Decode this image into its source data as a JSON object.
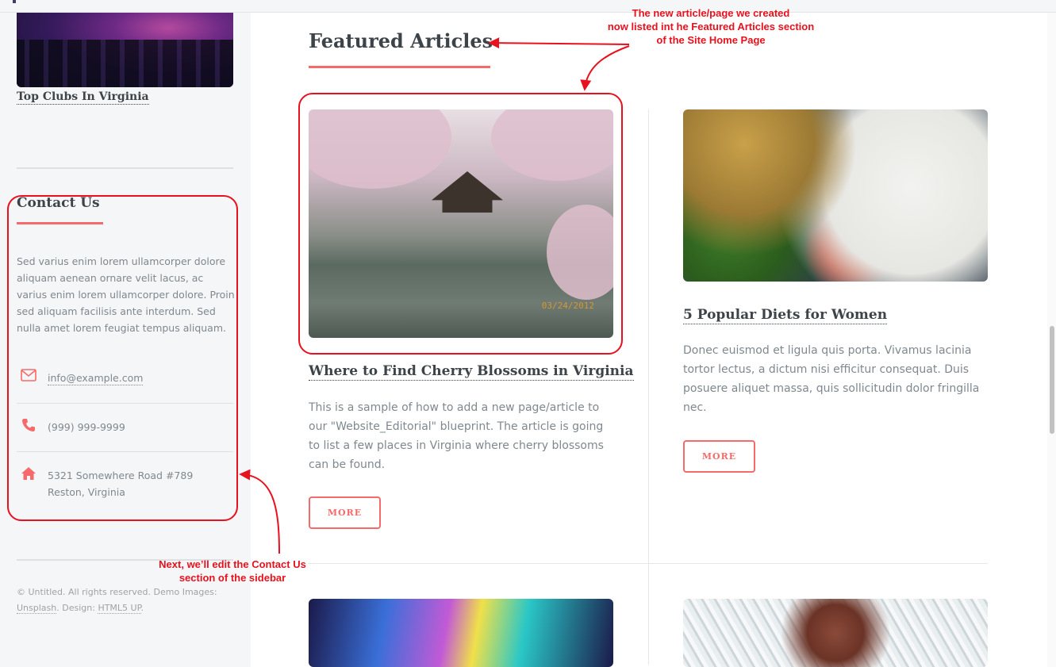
{
  "sidebar": {
    "recent_item_title": "Top Clubs In Virginia",
    "contact": {
      "heading": "Contact Us",
      "description": "Sed varius enim lorem ullamcorper dolore aliquam aenean ornare velit lacus, ac varius enim lorem ullamcorper dolore. Proin sed aliquam facilisis ante interdum. Sed nulla amet lorem feugiat tempus aliquam.",
      "email": "info@example.com",
      "phone": "(999) 999-9999",
      "address_line1": "5321 Somewhere Road #789",
      "address_line2": "Reston, Virginia"
    },
    "footer": {
      "prefix": "© Untitled. All rights reserved. Demo Images:",
      "unsplash": "Unsplash",
      "design_label": ". Design: ",
      "html5up": "HTML5 UP",
      "suffix": "."
    }
  },
  "main": {
    "section_title": "Featured Articles",
    "articles": [
      {
        "title": "Where to Find Cherry Blossoms in Virginia",
        "text": "This is a sample of how to add a new page/article to our \"Website_Editorial\" blueprint. The article is going to list a few places in Virginia where cherry blossoms can be found.",
        "button": "MORE",
        "image_caption_date": "03/24/2012"
      },
      {
        "title": "5 Popular Diets for Women",
        "text": "Donec euismod et ligula quis porta. Vivamus lacinia tortor lectus, a dictum nisi efficitur consequat. Duis posuere aliquet massa, quis sollicitudin dolor fringilla nec.",
        "button": "MORE"
      }
    ]
  },
  "annotations": {
    "featured_note": "The new article/page we created\nnow listed int he Featured Articles section\nof the Site Home Page",
    "contact_note": "Next, we’ll edit the Contact Us\nsection of the sidebar"
  },
  "icons": {
    "email": "envelope-icon",
    "phone": "phone-icon",
    "address": "home-icon"
  },
  "colors": {
    "accent": "#f56a6a",
    "annotation": "#e8111d",
    "heading": "#3d4449",
    "body_text": "#7f888f",
    "sidebar_bg": "#f5f6f7"
  }
}
